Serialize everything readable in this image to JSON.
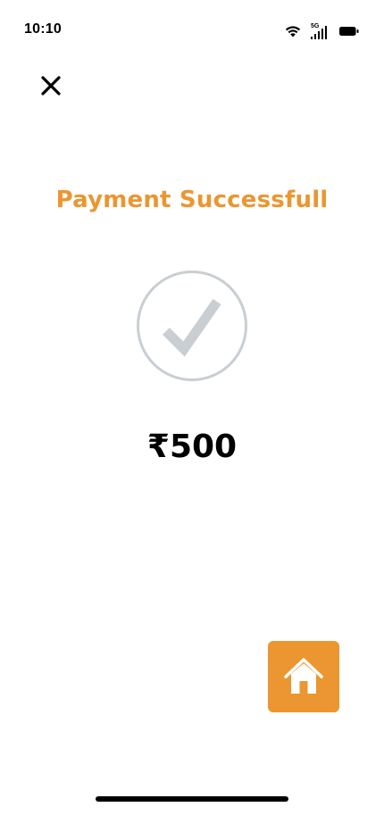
{
  "status_bar": {
    "time": "10:10",
    "network_label": "5G",
    "icons": [
      "wifi-icon",
      "cellular-signal-icon",
      "battery-icon"
    ]
  },
  "header": {
    "close_icon": "close-icon"
  },
  "main": {
    "title": "Payment Successfull",
    "status_icon": "check-circle-icon",
    "amount": "₹500"
  },
  "actions": {
    "home_icon": "home-icon"
  },
  "colors": {
    "accent": "#eb9630",
    "check_gray": "#c9ced3",
    "text": "#000000",
    "background": "#ffffff"
  }
}
